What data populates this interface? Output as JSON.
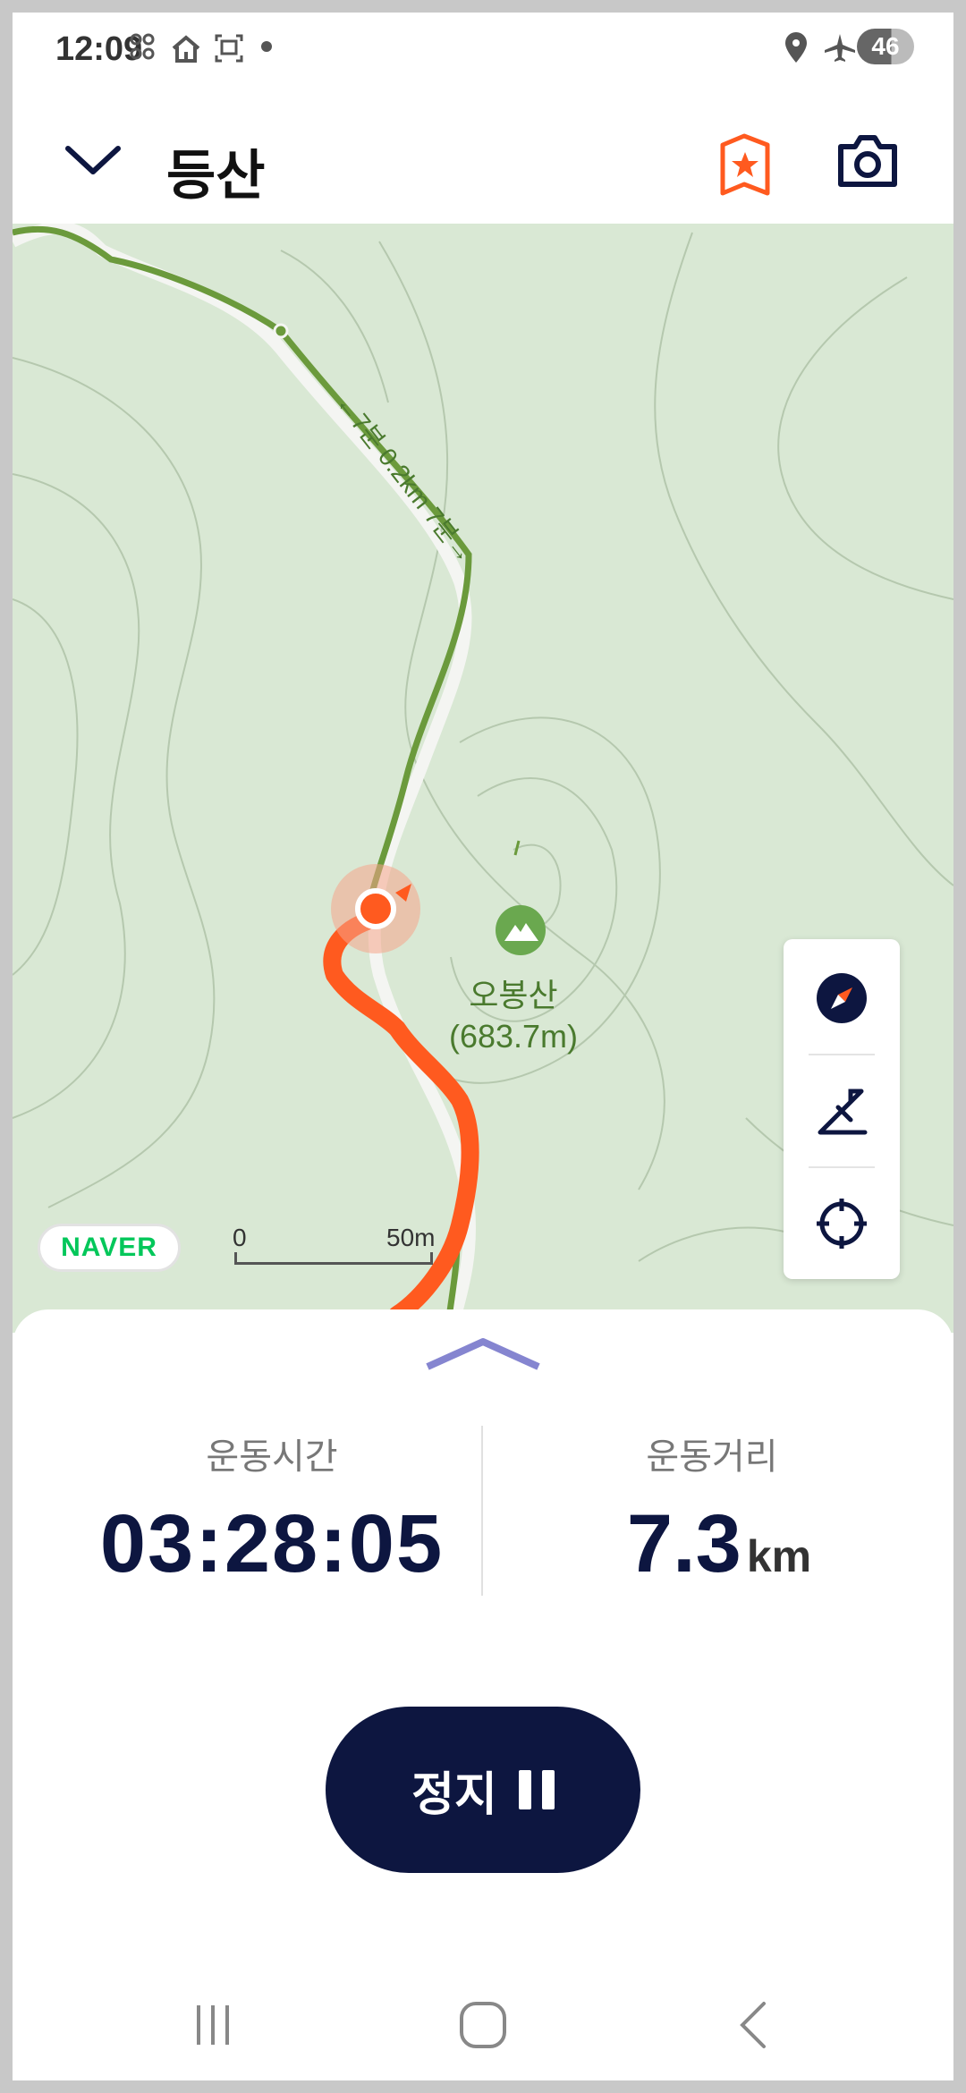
{
  "status_bar": {
    "time": "12:09",
    "battery": "46",
    "icons": [
      "lottery-icon",
      "home-icon",
      "image-icon",
      "dot-icon",
      "location-icon",
      "airplane-icon"
    ]
  },
  "header": {
    "title": "등산",
    "back_icon": "chevron-down-icon",
    "actions": [
      "mountain-badge-icon",
      "camera-icon"
    ]
  },
  "map": {
    "trail_label": "←7분 0.2km 7분→",
    "poi_name": "오봉산",
    "poi_elevation": "(683.7m)",
    "poi_icon": "mountain-icon",
    "logo": "NAVER",
    "scale_start": "0",
    "scale_end": "50m",
    "controls": [
      "compass-icon",
      "terrain-icon",
      "locate-icon"
    ],
    "colors": {
      "background": "#d9e8d4",
      "trail": "#6b9a3c",
      "route": "#ff5a1f"
    }
  },
  "stats": {
    "time_label": "운동시간",
    "time_value": "03:28:05",
    "distance_label": "운동거리",
    "distance_value": "7.3",
    "distance_unit": "km"
  },
  "controls": {
    "stop_label": "정지"
  },
  "colors": {
    "accent": "#0d1640",
    "orange": "#ff5a1f"
  }
}
